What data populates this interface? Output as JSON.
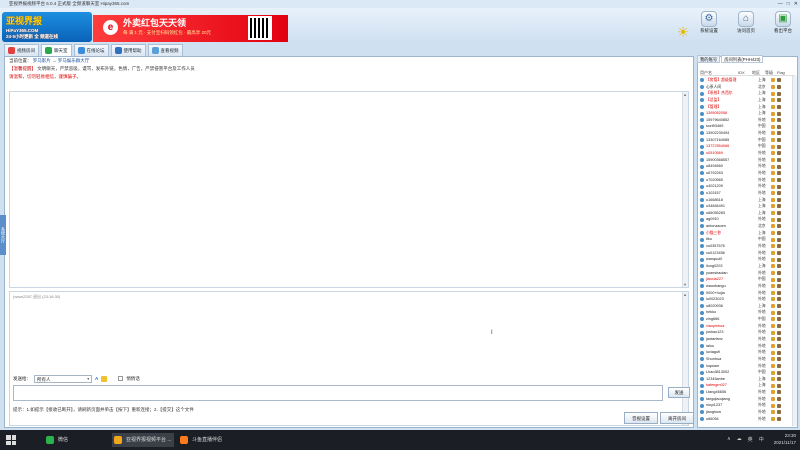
{
  "window": {
    "title": "亚视界报视频平台 6.0.4 正式版 全频道聊天室 Hipay365.com",
    "minimize": "—",
    "maximize": "□",
    "close": "✕"
  },
  "logo": {
    "brand": "亚视界报",
    "url": "HiPaY365.COM",
    "slogan": "24·5小时更新 全 频道在线"
  },
  "banner": {
    "icon": "e",
    "headline": "外卖红包天天领",
    "subline": "每 满 1 元 · 支付宝扫码领红包 · 最高享 20元"
  },
  "toolbar": [
    {
      "label": "系统设置",
      "icon": "gear-icon"
    },
    {
      "label": "访问首页",
      "icon": "home-icon"
    },
    {
      "label": "看出平台",
      "icon": "exit-icon"
    }
  ],
  "tabs": [
    {
      "label": "视频房间"
    },
    {
      "label": "聊天室"
    },
    {
      "label": "在线论坛"
    },
    {
      "label": "使用帮助"
    },
    {
      "label": "查看视频"
    }
  ],
  "main": {
    "crumb_prefix": "当前位置：",
    "crumb_1": "罗马影片",
    "crumb_sep": "→",
    "crumb_2": "罗马娱乐群大厅",
    "notice_label": "【温馨提醒】",
    "notice_text": "文明聊天，严禁恶吸，谩骂，发布外链，色情，广告，严禁侵害平台及工作人员",
    "warn": "请温和，切勿轻易相信，谨慎骗子。",
    "sidelabel": "系统大厅",
    "input_timestamp": "(www2287 退出 (23:18:30)"
  },
  "sendrow": {
    "label": "发送给：",
    "target": "所有人",
    "private_label": "悄悄话"
  },
  "send_button": "发送",
  "tip": "提示：1.如提示【接收已断开】，请刷新页面并单击【按下】重新连接；2.【提交】这个文件",
  "buttons": {
    "settings": "音视设置",
    "exit": "离开房间"
  },
  "right": {
    "tabs": [
      "我的账号",
      "房间列表(PHH423)"
    ],
    "columns": [
      "用户名",
      "IDX",
      "地区",
      "等级",
      "Flag"
    ],
    "users": [
      {
        "name": "【房管】超级管理",
        "loc": "上海",
        "red": true
      },
      {
        "name": "心系人间",
        "loc": "北京",
        "red": false
      },
      {
        "name": "【系统】杰西尔",
        "loc": "上海",
        "red": true
      },
      {
        "name": "【总监】",
        "loc": "上海",
        "red": true
      },
      {
        "name": "【管理】",
        "loc": "上海",
        "red": true
      },
      {
        "name": "1395052058",
        "loc": "上海",
        "red": true
      },
      {
        "name": "15979640852",
        "loc": "外地",
        "red": false
      },
      {
        "name": "sxzt93469",
        "loc": "中国",
        "red": false
      },
      {
        "name": "13902230494",
        "loc": "外地",
        "red": false
      },
      {
        "name": "13307164085",
        "loc": "中国",
        "red": false
      },
      {
        "name": "13727854066",
        "loc": "中国",
        "red": true
      },
      {
        "name": "u0510569",
        "loc": "外地",
        "red": true
      },
      {
        "name": "15900368557",
        "loc": "外地",
        "red": false
      },
      {
        "name": "u8494560",
        "loc": "外地",
        "red": false
      },
      {
        "name": "u6792263",
        "loc": "外地",
        "red": false
      },
      {
        "name": "u7020565",
        "loc": "外地",
        "red": false
      },
      {
        "name": "u4021209",
        "loc": "外地",
        "red": false
      },
      {
        "name": "u103157",
        "loc": "外地",
        "red": false
      },
      {
        "name": "u1668518",
        "loc": "上海",
        "red": false
      },
      {
        "name": "u34846491",
        "loc": "上海",
        "red": false
      },
      {
        "name": "u66055283",
        "loc": "上海",
        "red": false
      },
      {
        "name": "ag0910",
        "loc": "外地",
        "red": false
      },
      {
        "name": "antonzaoen",
        "loc": "北京",
        "red": false
      },
      {
        "name": "小猫三秒",
        "loc": "上海",
        "red": true
      },
      {
        "name": "tiko",
        "loc": "中国",
        "red": false
      },
      {
        "name": "xu0357676",
        "loc": "外地",
        "red": false
      },
      {
        "name": "xu0123456",
        "loc": "外地",
        "red": false
      },
      {
        "name": "wanquul0",
        "loc": "外地",
        "red": false
      },
      {
        "name": "ilung0203",
        "loc": "上海",
        "red": false
      },
      {
        "name": "yuanshaoian",
        "loc": "外地",
        "red": false
      },
      {
        "name": "jiaoxia227",
        "loc": "中国",
        "red": true
      },
      {
        "name": "waoobangu",
        "loc": "外地",
        "red": false
      },
      {
        "name": "0000+hujia",
        "loc": "外地",
        "red": false
      },
      {
        "name": "lu0023023",
        "loc": "外地",
        "red": false
      },
      {
        "name": "u8020936",
        "loc": "上海",
        "red": false
      },
      {
        "name": "hekko",
        "loc": "外地",
        "red": false
      },
      {
        "name": "zing666",
        "loc": "中国",
        "red": false
      },
      {
        "name": "xiaopinhua",
        "loc": "外地",
        "red": true
      },
      {
        "name": "jushao123",
        "loc": "外地",
        "red": false
      },
      {
        "name": "jaotarfanv",
        "loc": "外地",
        "red": false
      },
      {
        "name": "ialoo",
        "loc": "外地",
        "red": false
      },
      {
        "name": "luxiagufi",
        "loc": "外地",
        "red": false
      },
      {
        "name": "Shunhua",
        "loc": "外地",
        "red": false
      },
      {
        "name": "luquiam",
        "loc": "外地",
        "red": false
      },
      {
        "name": "Lhao3813002",
        "loc": "中国",
        "red": false
      },
      {
        "name": "12345anhe",
        "loc": "上海",
        "red": false
      },
      {
        "name": "kafengm027",
        "loc": "上海",
        "red": true
      },
      {
        "name": "Lfang46656",
        "loc": "外地",
        "red": false
      },
      {
        "name": "Iangqiaoqiang",
        "loc": "外地",
        "red": false
      },
      {
        "name": "niuyi1237",
        "loc": "外地",
        "red": false
      },
      {
        "name": "jianghuw",
        "loc": "外地",
        "red": false
      },
      {
        "name": "u66054",
        "loc": "外地",
        "red": false
      }
    ]
  },
  "taskbar": {
    "items": [
      "微信",
      "亚视界报视频平台 ...",
      "斗鱼直播伴侣"
    ],
    "tray_items": [
      "∧",
      "☁",
      "英",
      "中"
    ],
    "time": "23:30",
    "date": "2021/11/17"
  },
  "colors": {
    "accent": "#3c8ad8",
    "warn": "#d00000",
    "banner_red": "#e20010"
  }
}
